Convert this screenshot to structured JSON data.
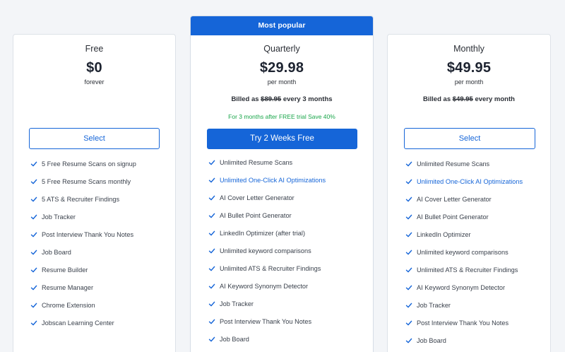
{
  "plans": [
    {
      "id": "free",
      "name": "Free",
      "price": "$0",
      "period": "forever",
      "button_label": "Select",
      "features": [
        {
          "text": "5 Free Resume Scans on signup",
          "highlight": false
        },
        {
          "text": "5 Free Resume Scans monthly",
          "highlight": false
        },
        {
          "text": "5 ATS & Recruiter Findings",
          "highlight": false
        },
        {
          "text": "Job Tracker",
          "highlight": false
        },
        {
          "text": "Post Interview Thank You Notes",
          "highlight": false
        },
        {
          "text": "Job Board",
          "highlight": false
        },
        {
          "text": "Resume Builder",
          "highlight": false
        },
        {
          "text": "Resume Manager",
          "highlight": false
        },
        {
          "text": "Chrome Extension",
          "highlight": false
        },
        {
          "text": "Jobscan Learning Center",
          "highlight": false
        }
      ]
    },
    {
      "id": "quarterly",
      "badge": "Most popular",
      "name": "Quarterly",
      "price": "$29.98",
      "period": "per month",
      "billed_prefix": "Billed as ",
      "billed_strike": "$89.95",
      "billed_suffix": " every 3 months",
      "promo": "For 3 months after FREE trial Save 40%",
      "button_label": "Try 2 Weeks Free",
      "features": [
        {
          "text": "Unlimited Resume Scans",
          "highlight": false
        },
        {
          "text": "Unlimited One-Click AI Optimizations",
          "highlight": true
        },
        {
          "text": "AI Cover Letter Generator",
          "highlight": false
        },
        {
          "text": "AI Bullet Point Generator",
          "highlight": false
        },
        {
          "text": "LinkedIn Optimizer (after trial)",
          "highlight": false
        },
        {
          "text": "Unlimited keyword comparisons",
          "highlight": false
        },
        {
          "text": "Unlimited ATS & Recruiter Findings",
          "highlight": false
        },
        {
          "text": "AI Keyword Synonym Detector",
          "highlight": false
        },
        {
          "text": "Job Tracker",
          "highlight": false
        },
        {
          "text": "Post Interview Thank You Notes",
          "highlight": false
        },
        {
          "text": "Job Board",
          "highlight": false
        }
      ]
    },
    {
      "id": "monthly",
      "name": "Monthly",
      "price": "$49.95",
      "period": "per month",
      "billed_prefix": "Billed as ",
      "billed_strike": "$49.95",
      "billed_suffix": " every month",
      "button_label": "Select",
      "features": [
        {
          "text": "Unlimited Resume Scans",
          "highlight": false
        },
        {
          "text": "Unlimited One-Click AI Optimizations",
          "highlight": true
        },
        {
          "text": "AI Cover Letter Generator",
          "highlight": false
        },
        {
          "text": "AI Bullet Point Generator",
          "highlight": false
        },
        {
          "text": "LinkedIn Optimizer",
          "highlight": false
        },
        {
          "text": "Unlimited keyword comparisons",
          "highlight": false
        },
        {
          "text": "Unlimited ATS & Recruiter Findings",
          "highlight": false
        },
        {
          "text": "AI Keyword Synonym Detector",
          "highlight": false
        },
        {
          "text": "Job Tracker",
          "highlight": false
        },
        {
          "text": "Post Interview Thank You Notes",
          "highlight": false
        },
        {
          "text": "Job Board",
          "highlight": false
        }
      ]
    }
  ],
  "icons": {
    "feature_check": "check-icon"
  },
  "colors": {
    "accent": "#1565d8",
    "promo_green": "#19a64a",
    "page_background": "#f3f5f8",
    "card_border": "#dde2e8"
  }
}
